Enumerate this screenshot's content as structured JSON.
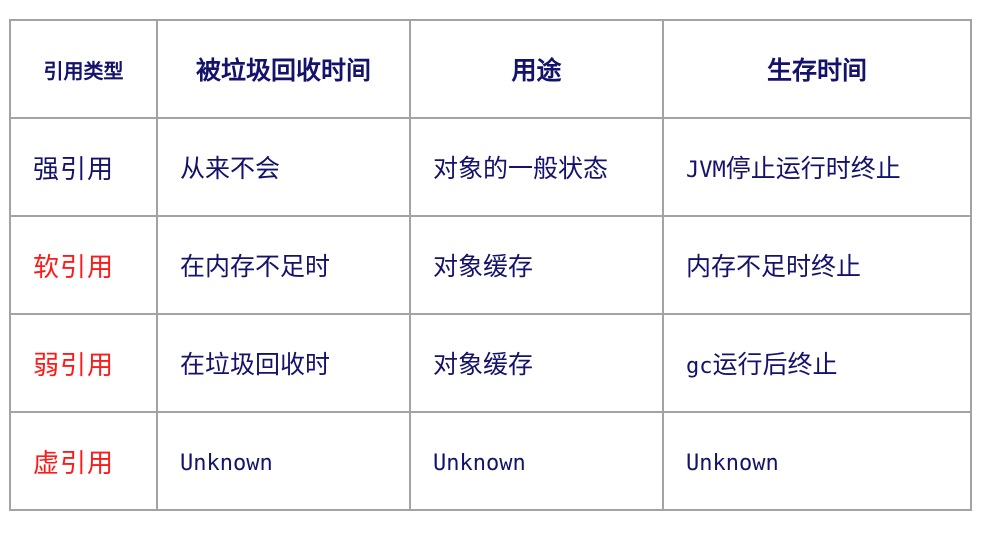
{
  "colors": {
    "text": "#14126b",
    "highlight": "#ff1a1a",
    "border": "#a3a3a3"
  },
  "table": {
    "headers": [
      "引用类型",
      "被垃圾回收时间",
      "用途",
      "生存时间"
    ],
    "rows": [
      {
        "type": "强引用",
        "type_highlight": false,
        "gc_time": "从来不会",
        "usage": "对象的一般状态",
        "lifetime_prefix": "JVM",
        "lifetime_rest": "停止运行时终止"
      },
      {
        "type": "软引用",
        "type_highlight": true,
        "gc_time": "在内存不足时",
        "usage": "对象缓存",
        "lifetime_prefix": "",
        "lifetime_rest": "内存不足时终止"
      },
      {
        "type": "弱引用",
        "type_highlight": true,
        "gc_time": "在垃圾回收时",
        "usage": "对象缓存",
        "lifetime_prefix": "gc",
        "lifetime_rest": "运行后终止"
      },
      {
        "type": "虚引用",
        "type_highlight": true,
        "gc_time": "Unknown",
        "usage": "Unknown",
        "lifetime_prefix": "Unknown",
        "lifetime_rest": ""
      }
    ]
  }
}
